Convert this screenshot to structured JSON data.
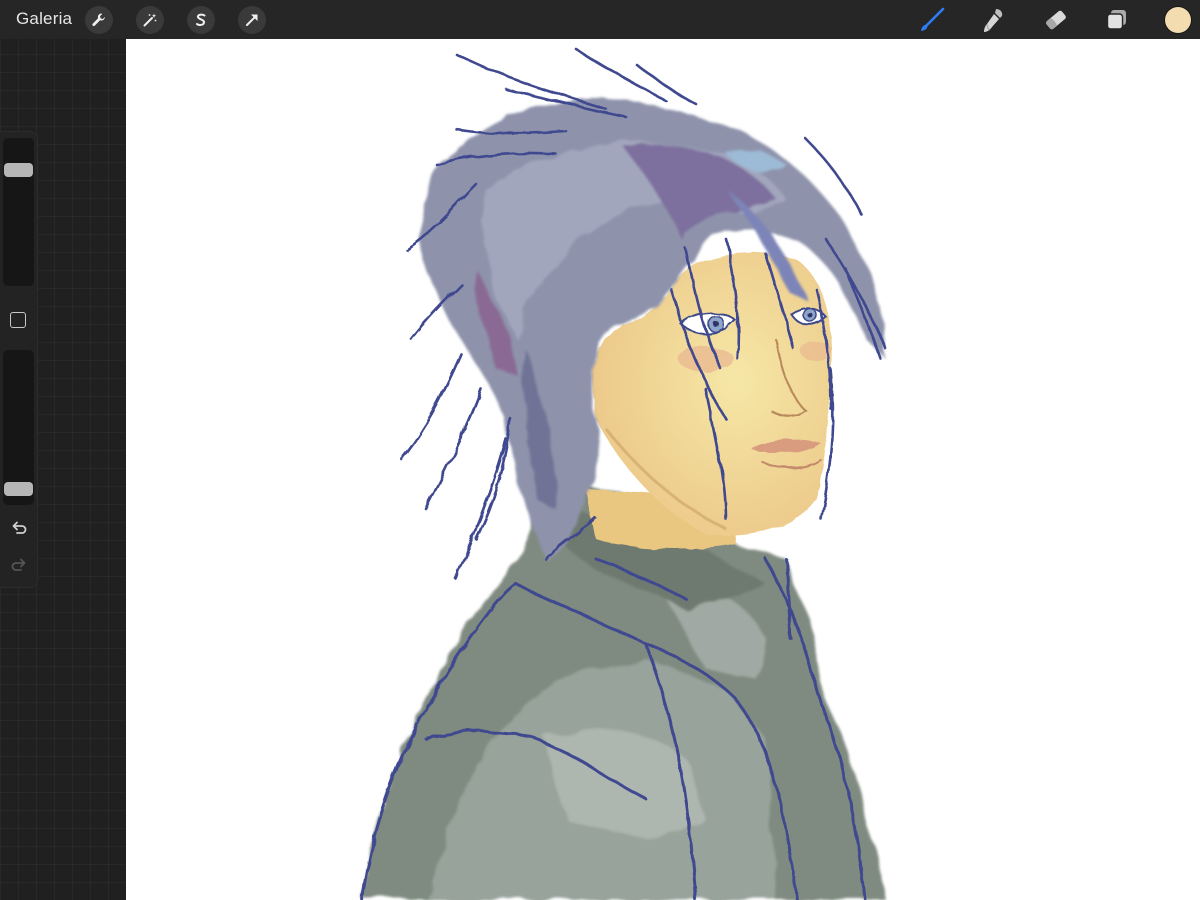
{
  "topbar": {
    "gallery_label": "Galeria",
    "actions": [
      {
        "name": "actions-icon"
      },
      {
        "name": "adjustments-icon"
      },
      {
        "name": "selection-icon"
      },
      {
        "name": "transform-icon"
      }
    ],
    "tools": [
      {
        "name": "brush-icon",
        "active": true
      },
      {
        "name": "smudge-icon",
        "active": false
      },
      {
        "name": "eraser-icon",
        "active": false
      },
      {
        "name": "layers-icon",
        "active": false
      }
    ],
    "active_tool_color": "#2f7cf6",
    "current_color": "#f2dcb0"
  },
  "sidebar": {
    "brush_size_level": 0.82,
    "opacity_level": 0.06,
    "modify_icon": "square-icon",
    "undo_icon": "undo-icon",
    "redo_icon": "redo-icon"
  },
  "canvas": {
    "background_color": "#ffffff",
    "artwork": "painted-portrait-illustration"
  }
}
